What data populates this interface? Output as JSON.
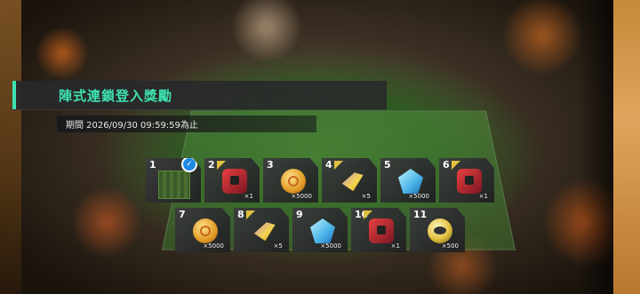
{
  "panel": {
    "title": "陣式連鎖登入獎勵",
    "period": "期間 2026/09/30 09:59:59為止"
  },
  "rewards": [
    {
      "day": "1",
      "icon": "formation-thumbnail-icon",
      "quantity": "",
      "claimed": true
    },
    {
      "day": "2",
      "icon": "red-bag-icon",
      "quantity": "×1",
      "claimed": false
    },
    {
      "day": "3",
      "icon": "gold-coin-icon",
      "quantity": "×5000",
      "claimed": false
    },
    {
      "day": "4",
      "icon": "boost-ticket-icon",
      "quantity": "×5",
      "claimed": false
    },
    {
      "day": "5",
      "icon": "blue-gem-icon",
      "quantity": "×5000",
      "claimed": false
    },
    {
      "day": "6",
      "icon": "red-bag-icon",
      "quantity": "×1",
      "claimed": false
    },
    {
      "day": "7",
      "icon": "gold-coin-icon",
      "quantity": "×5000",
      "claimed": false
    },
    {
      "day": "8",
      "icon": "boost-ticket-icon",
      "quantity": "×5",
      "claimed": false
    },
    {
      "day": "9",
      "icon": "blue-gem-icon",
      "quantity": "×5000",
      "claimed": false
    },
    {
      "day": "10",
      "icon": "red-bag-icon",
      "quantity": "×1",
      "claimed": false
    },
    {
      "day": "11",
      "icon": "gold-token-icon",
      "quantity": "×500",
      "claimed": false
    }
  ],
  "colors": {
    "accent": "#3ee2b0",
    "claimed_check": "#1e88e5"
  }
}
